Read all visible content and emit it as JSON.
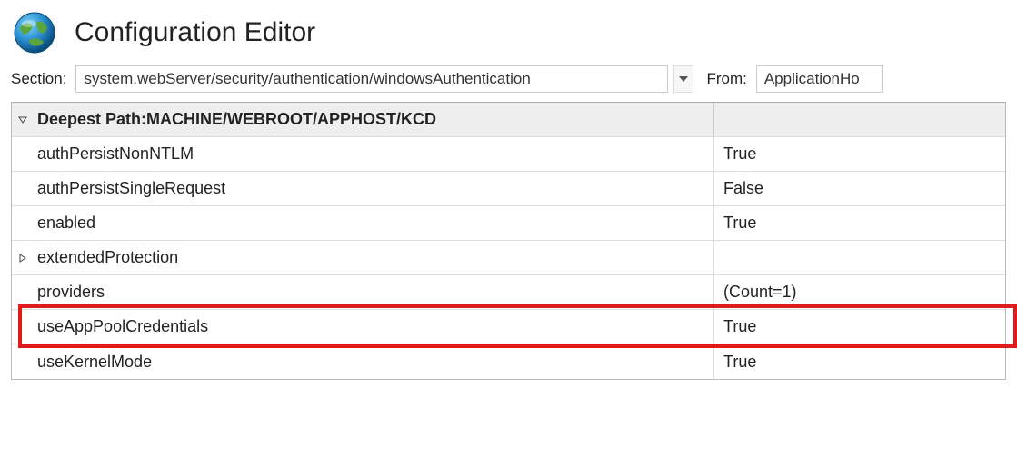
{
  "header": {
    "title": "Configuration Editor"
  },
  "toolbar": {
    "section_label": "Section:",
    "section_value": "system.webServer/security/authentication/windowsAuthentication",
    "from_label": "From:",
    "from_value": "ApplicationHo"
  },
  "grid": {
    "path_label_prefix": "Deepest Path: ",
    "path_value": "MACHINE/WEBROOT/APPHOST/KCD",
    "rows": [
      {
        "name": "authPersistNonNTLM",
        "value": "True"
      },
      {
        "name": "authPersistSingleRequest",
        "value": "False"
      },
      {
        "name": "enabled",
        "value": "True"
      },
      {
        "name": "extendedProtection",
        "value": "",
        "expandable": true
      },
      {
        "name": "providers",
        "value": "(Count=1)"
      },
      {
        "name": "useAppPoolCredentials",
        "value": "True",
        "highlighted": true
      },
      {
        "name": "useKernelMode",
        "value": "True"
      }
    ]
  }
}
